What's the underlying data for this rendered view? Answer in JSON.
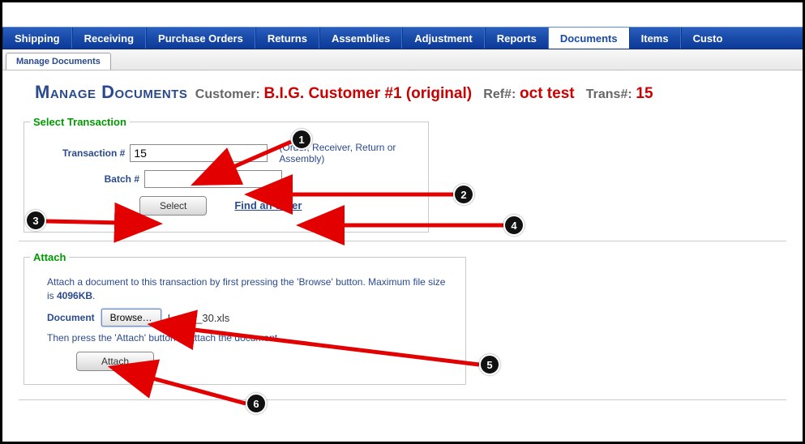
{
  "nav": {
    "items": [
      "Shipping",
      "Receiving",
      "Purchase Orders",
      "Returns",
      "Assemblies",
      "Adjustment",
      "Reports",
      "Documents",
      "Items",
      "Custo"
    ],
    "active_index": 7
  },
  "subtab": {
    "label": "Manage Documents"
  },
  "header": {
    "title": "Manage Documents",
    "customer_label": "Customer:",
    "customer": "B.I.G. Customer #1 (original)",
    "ref_label": "Ref#:",
    "ref": "oct test",
    "trans_label": "Trans#:",
    "trans": "15"
  },
  "select_section": {
    "legend": "Select Transaction",
    "transaction_label": "Transaction #",
    "transaction_value": "15",
    "batch_label": "Batch #",
    "batch_value": "",
    "hint": "(Order, Receiver, Return or Assembly)",
    "select_button": "Select",
    "find_order": "Find an order"
  },
  "attach_section": {
    "legend": "Attach",
    "instr1_a": "Attach a document to this transaction by first pressing the 'Browse' button. Maximum file size is ",
    "instr1_b": "4096KB",
    "instr1_c": ".",
    "doc_label": "Document",
    "browse_button": "Browse…",
    "filename": "Loc_3_30.xls",
    "instr2": "Then press the 'Attach' button to attach the document.",
    "attach_button": "Attach"
  },
  "markers": {
    "1": "1",
    "2": "2",
    "3": "3",
    "4": "4",
    "5": "5",
    "6": "6"
  }
}
